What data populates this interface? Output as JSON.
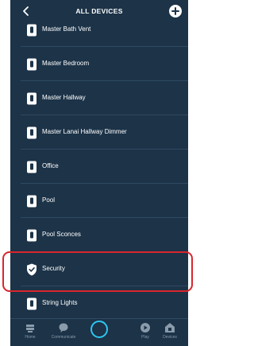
{
  "header": {
    "title": "ALL DEVICES",
    "back_icon": "chevron-left-icon",
    "add_icon": "plus-circle-icon"
  },
  "devices": [
    {
      "label": "Master Bath Vent",
      "icon": "switch-icon"
    },
    {
      "label": "Master Bedroom",
      "icon": "switch-icon"
    },
    {
      "label": "Master Hallway",
      "icon": "switch-icon"
    },
    {
      "label": "Master Lanai Hallway Dimmer",
      "icon": "switch-icon"
    },
    {
      "label": "Office",
      "icon": "switch-icon"
    },
    {
      "label": "Pool",
      "icon": "switch-icon"
    },
    {
      "label": "Pool Sconces",
      "icon": "switch-icon"
    },
    {
      "label": "Security",
      "icon": "shield-check-icon"
    },
    {
      "label": "String Lights",
      "icon": "switch-icon"
    }
  ],
  "bottom_nav": {
    "home": "Home",
    "communicate": "Communicate",
    "play": "Play",
    "devices": "Devices"
  },
  "colors": {
    "background": "#1c3348",
    "separator": "#2f4a62",
    "highlight": "#d8262c",
    "alexa_ring": "#2ec5f0",
    "nav_label": "#8a9bab"
  }
}
